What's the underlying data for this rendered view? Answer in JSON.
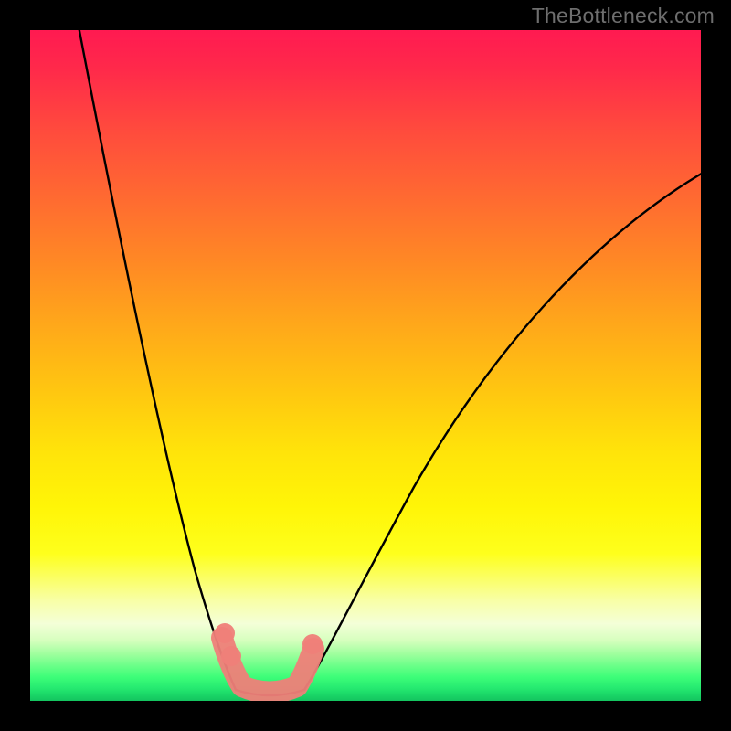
{
  "watermark": "TheBottleneck.com",
  "chart_data": {
    "type": "line",
    "title": "",
    "xlabel": "",
    "ylabel": "",
    "xlim": [
      0,
      100
    ],
    "ylim": [
      0,
      100
    ],
    "grid": false,
    "legend": false,
    "background": {
      "style": "vertical-gradient",
      "description": "Heat gradient from red (top / high bottleneck) through orange/yellow to green (bottom / optimal).",
      "stops": [
        {
          "pos": 0.0,
          "color": "#ff1a51"
        },
        {
          "pos": 0.35,
          "color": "#ff8a24"
        },
        {
          "pos": 0.63,
          "color": "#ffe40a"
        },
        {
          "pos": 0.88,
          "color": "#f4ffd8"
        },
        {
          "pos": 1.0,
          "color": "#14c45f"
        }
      ]
    },
    "series": [
      {
        "name": "bottleneck-curve",
        "description": "V-shaped curve; y≈100 at extremes, dipping to ≈0 where the two shoulders meet (x roughly 30–40).",
        "x": [
          7,
          12,
          18,
          24,
          30,
          33,
          36,
          39,
          42,
          48,
          56,
          66,
          78,
          90,
          100
        ],
        "y": [
          100,
          78,
          55,
          30,
          10,
          2,
          0,
          1,
          4,
          15,
          30,
          48,
          63,
          74,
          80
        ]
      }
    ],
    "markers": {
      "name": "highlighted-range",
      "color": "#ef8079",
      "description": "Rounded salmon overlay tracing the valley of the curve, roughly x∈[28,43], y∈[0,12].",
      "points": [
        {
          "x": 28,
          "y": 12
        },
        {
          "x": 31,
          "y": 4
        },
        {
          "x": 36,
          "y": 0
        },
        {
          "x": 40,
          "y": 3
        },
        {
          "x": 43,
          "y": 10
        }
      ]
    }
  }
}
